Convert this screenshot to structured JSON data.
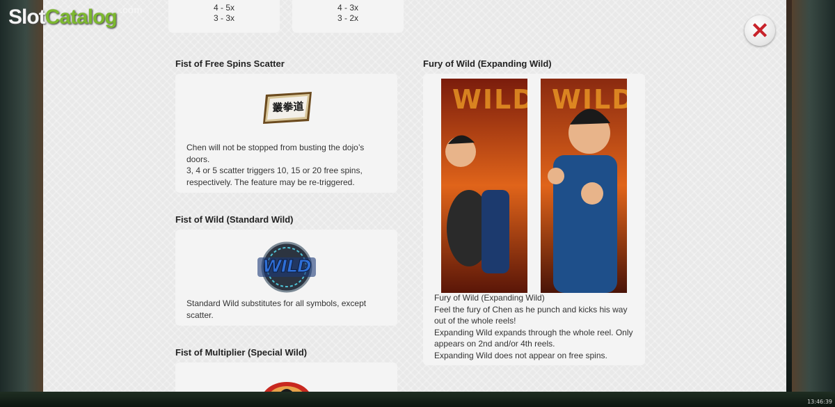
{
  "logo": {
    "slot": "Slot",
    "catalog": "Catalog",
    "com": ".com"
  },
  "clock": "13:46:39",
  "close_button": {
    "icon": "close-x-icon",
    "glyph": "✕"
  },
  "payout_cards": [
    {
      "lines": [
        "4 - 5x",
        "3 - 3x"
      ]
    },
    {
      "lines": [
        "4 - 3x",
        "3 - 2x"
      ]
    }
  ],
  "sections": {
    "scatter": {
      "title": "Fist of Free Spins Scatter",
      "symbol_text": "叢拳道",
      "description": [
        "Chen will not be stopped from busting the dojo’s",
        "doors.",
        "3, 4 or 5 scatter triggers 10, 15 or 20 free spins,",
        "respectively. The feature may be re-triggered."
      ]
    },
    "standard_wild": {
      "title": "Fist of Wild (Standard Wild)",
      "symbol_text": "WILD",
      "description": [
        "Standard Wild substitutes for all symbols, except",
        "scatter."
      ]
    },
    "multiplier": {
      "title": "Fist of Multiplier (Special Wild)"
    },
    "expanding_wild": {
      "title": "Fury of Wild (Expanding Wild)",
      "reel_text_1": "WILD",
      "reel_text_2": "WILD",
      "description": [
        "Fury of Wild (Expanding Wild)",
        "Feel the fury of Chen as he punch and kicks his way",
        "out of the whole reels!",
        "Expanding Wild expands through the whole reel. Only",
        "appears on 2nd and/or 4th reels.",
        "Expanding Wild does not appear on free spins."
      ]
    }
  }
}
